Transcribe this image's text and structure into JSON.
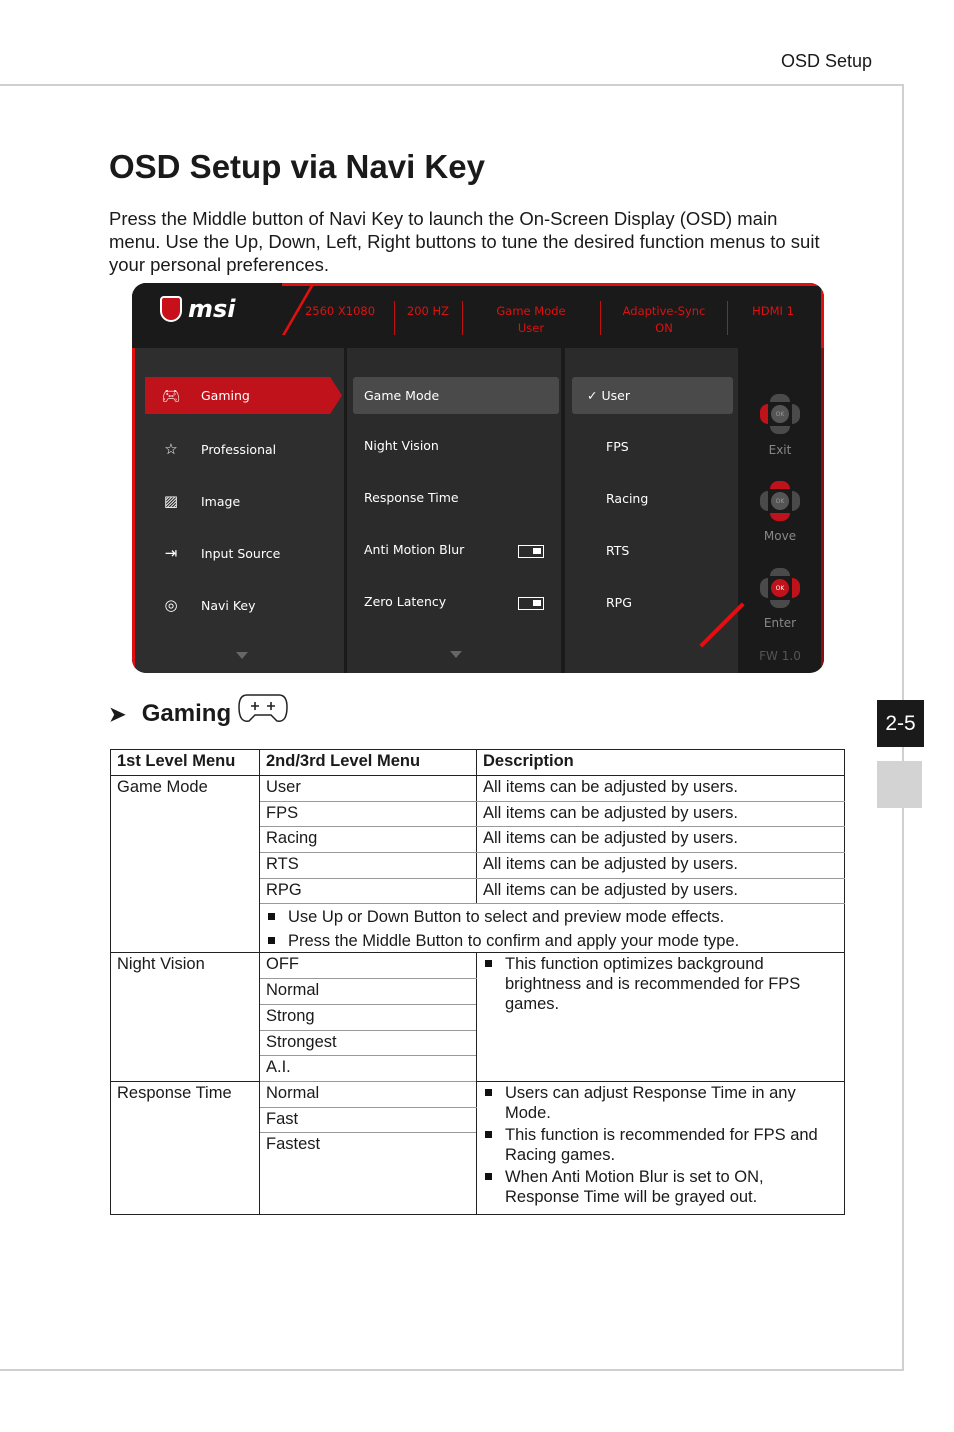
{
  "header": {
    "section": "OSD Setup"
  },
  "title": "OSD Setup via Navi Key",
  "intro": "Press the Middle button of Navi Key to launch the On-Screen Display (OSD) main menu. Use the Up, Down, Left, Right buttons to tune the desired function menus to suit your personal preferences.",
  "osd": {
    "logo": "msi",
    "status": [
      {
        "l1": "2560 X1080"
      },
      {
        "l1": "200 HZ"
      },
      {
        "l1": "Game Mode",
        "l2": "User"
      },
      {
        "l1": "Adaptive-Sync",
        "l2": "ON"
      },
      {
        "l1": "HDMI 1"
      }
    ],
    "menu1": [
      {
        "label": "Gaming",
        "icon": "gamepad-icon"
      },
      {
        "label": "Professional",
        "icon": "star-icon"
      },
      {
        "label": "Image",
        "icon": "image-icon"
      },
      {
        "label": "Input Source",
        "icon": "input-icon"
      },
      {
        "label": "Navi Key",
        "icon": "navi-key-icon"
      }
    ],
    "menu2": [
      "Game Mode",
      "Night Vision",
      "Response Time",
      "Anti Motion Blur",
      "Zero Latency"
    ],
    "menu3": [
      "User",
      "FPS",
      "Racing",
      "RTS",
      "RPG"
    ],
    "keys": {
      "exit": "Exit",
      "move": "Move",
      "enter": "Enter",
      "ok": "OK",
      "fw": "FW 1.0"
    },
    "accent": "#e01010"
  },
  "section": {
    "title": "Gaming"
  },
  "table": {
    "headers": [
      "1st Level Menu",
      "2nd/3rd Level Menu",
      "Description"
    ],
    "game_mode": {
      "name": "Game Mode",
      "options": [
        "User",
        "FPS",
        "Racing",
        "RTS",
        "RPG"
      ],
      "desc": "All items can be adjusted by users.",
      "notes": [
        "Use Up or Down Button to select and preview mode effects.",
        "Press the Middle Button to confirm and apply your mode type."
      ]
    },
    "night_vision": {
      "name": "Night Vision",
      "options": [
        "OFF",
        "Normal",
        "Strong",
        "Strongest",
        "A.I."
      ],
      "desc": "This function optimizes background brightness and is recommended for FPS games."
    },
    "response_time": {
      "name": "Response Time",
      "options": [
        "Normal",
        "Fast",
        "Fastest"
      ],
      "desc": [
        "Users can adjust Response Time in any Mode.",
        "This function is recommended for FPS and Racing games.",
        "When Anti Motion Blur is set to ON, Response Time will be grayed out."
      ]
    }
  },
  "page_tab": "2-5"
}
